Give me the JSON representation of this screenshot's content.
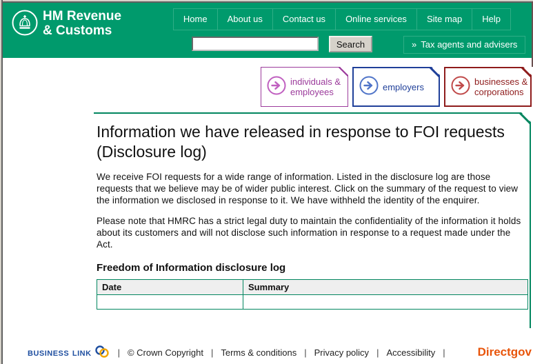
{
  "header": {
    "logo_line1": "HM Revenue",
    "logo_line2": "& Customs",
    "nav_items": [
      "Home",
      "About us",
      "Contact us",
      "Online services",
      "Site map",
      "Help"
    ],
    "search_input_value": "",
    "search_button_label": "Search",
    "tax_agents_chevron": "»",
    "tax_agents_label": "Tax agents and advisers",
    "background_color": "#009A6C",
    "nav_border_color": "#2FAE86"
  },
  "audience_boxes": [
    {
      "label": "individuals & employees",
      "color": "#9B3A9B"
    },
    {
      "label": "employers",
      "color": "#1F3F99"
    },
    {
      "label": "businesses & corporations",
      "color": "#8E1B1B"
    }
  ],
  "main": {
    "title": "Information we have released in response to FOI requests (Disclosure log)",
    "paragraph1": "We receive FOI requests for a wide range of information. Listed in the disclosure log are those requests that we believe may be of wider public interest. Click on the summary of the request to view the information we disclosed in response to it. We have withheld the identity of the enquirer.",
    "paragraph2": "Please note that HMRC has a strict legal duty to maintain the confidentiality of the information it holds about its customers and will not disclose such information in response to a request made under the Act.",
    "table_heading": "Freedom of Information disclosure log",
    "table": {
      "columns": [
        "Date",
        "Summary"
      ],
      "rows": [
        {
          "date": "",
          "summary": ""
        }
      ]
    },
    "panel_border_color": "#00855E"
  },
  "footer": {
    "business_link_label": "Business Link",
    "business_link_color": "#1F4FA0",
    "separator": "|",
    "links": [
      "© Crown Copyright",
      "Terms & conditions",
      "Privacy policy",
      "Accessibility"
    ],
    "directgov_label": "Directgov",
    "directgov_color": "#E8540A"
  }
}
